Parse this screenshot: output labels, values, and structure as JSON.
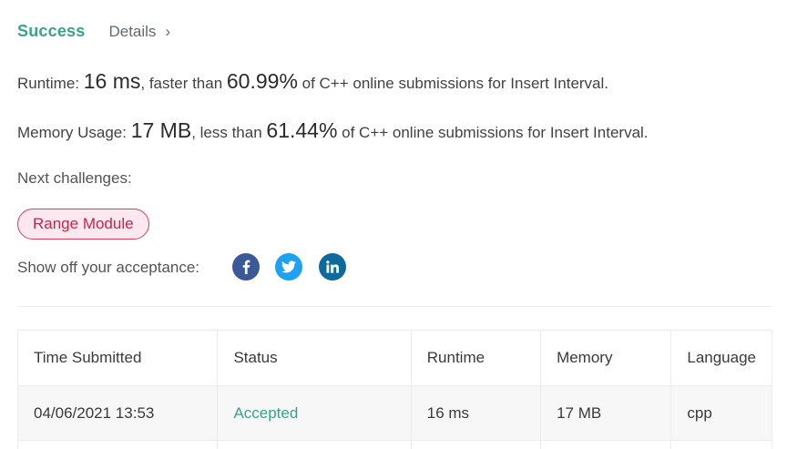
{
  "header": {
    "status": "Success",
    "details_label": "Details",
    "details_chevron": "›"
  },
  "runtime": {
    "label": "Runtime: ",
    "value": "16 ms",
    "comparison_prefix": ", faster than ",
    "percent": "60.99%",
    "suffix": " of C++ online submissions for Insert Interval."
  },
  "memory": {
    "label": "Memory Usage: ",
    "value": "17 MB",
    "comparison_prefix": ", less than ",
    "percent": "61.44%",
    "suffix": " of C++ online submissions for Insert Interval."
  },
  "next_challenges": {
    "label": "Next challenges:",
    "items": [
      "Range Module"
    ]
  },
  "share": {
    "label": "Show off your acceptance:",
    "icons": [
      "facebook-icon",
      "twitter-icon",
      "linkedin-icon"
    ],
    "colors": {
      "facebook": "#3b5998",
      "twitter": "#1da1f2",
      "linkedin": "#0e6a9c"
    }
  },
  "table": {
    "columns": [
      "Time Submitted",
      "Status",
      "Runtime",
      "Memory",
      "Language"
    ],
    "rows": [
      [
        "04/06/2021 13:53",
        "Accepted",
        "16 ms",
        "17 MB",
        "cpp"
      ]
    ]
  },
  "colors": {
    "accent": "#3aa38b",
    "challenge_border": "#d33f63",
    "challenge_bg": "#fce8ee"
  }
}
